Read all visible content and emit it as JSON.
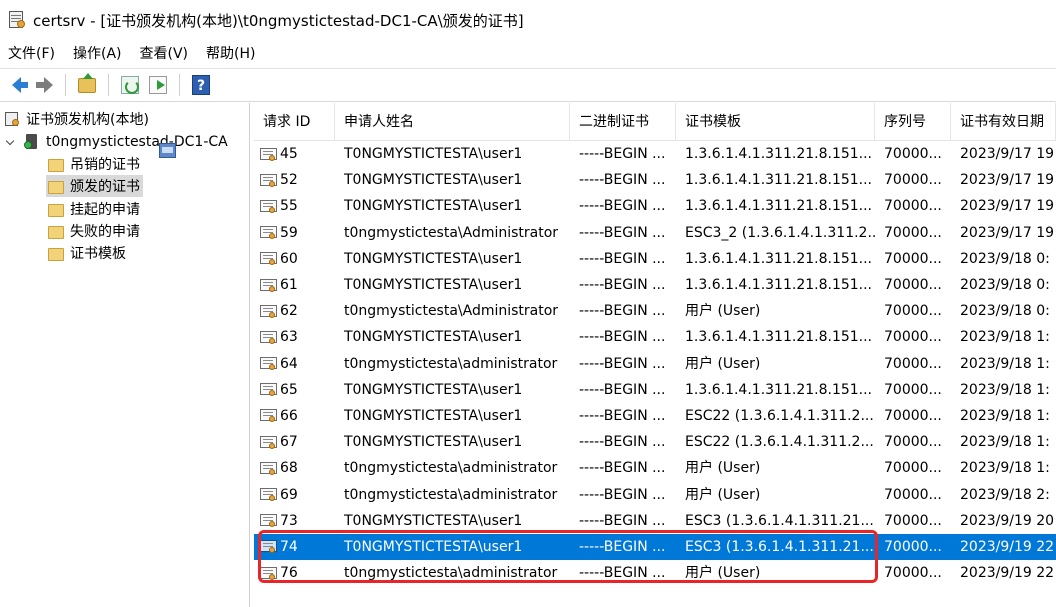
{
  "window": {
    "title": "certsrv - [证书颁发机构(本地)\\t0ngmystictestad-DC1-CA\\颁发的证书]"
  },
  "menu": [
    "文件(F)",
    "操作(A)",
    "查看(V)",
    "帮助(H)"
  ],
  "toolbar": {
    "buttons": [
      "back",
      "forward",
      "up-folder",
      "refresh",
      "export-list",
      "help"
    ],
    "help_glyph": "?"
  },
  "tree": {
    "root": "证书颁发机构(本地)",
    "ca": "t0ngmystictestad-DC1-CA",
    "folders": [
      "吊销的证书",
      "颁发的证书",
      "挂起的申请",
      "失败的申请",
      "证书模板"
    ],
    "selected": "颁发的证书"
  },
  "columns": [
    "请求 ID",
    "申请人姓名",
    "二进制证书",
    "证书模板",
    "序列号",
    "证书有效日期"
  ],
  "rows": [
    {
      "id": "45",
      "name": "T0NGMYSTICTESTA\\user1",
      "binary": "-----BEGIN ...",
      "template": "1.3.6.1.4.1.311.21.8.151...",
      "serial": "70000...",
      "date": "2023/9/17 19"
    },
    {
      "id": "52",
      "name": "T0NGMYSTICTESTA\\user1",
      "binary": "-----BEGIN ...",
      "template": "1.3.6.1.4.1.311.21.8.151...",
      "serial": "70000...",
      "date": "2023/9/17 19"
    },
    {
      "id": "55",
      "name": "T0NGMYSTICTESTA\\user1",
      "binary": "-----BEGIN ...",
      "template": "1.3.6.1.4.1.311.21.8.151...",
      "serial": "70000...",
      "date": "2023/9/17 19"
    },
    {
      "id": "59",
      "name": "t0ngmystictesta\\Administrator",
      "binary": "-----BEGIN ...",
      "template": "ESC3_2 (1.3.6.1.4.1.311.2...",
      "serial": "70000...",
      "date": "2023/9/17 19"
    },
    {
      "id": "60",
      "name": "T0NGMYSTICTESTA\\user1",
      "binary": "-----BEGIN ...",
      "template": "1.3.6.1.4.1.311.21.8.151...",
      "serial": "70000...",
      "date": "2023/9/18 0:"
    },
    {
      "id": "61",
      "name": "T0NGMYSTICTESTA\\user1",
      "binary": "-----BEGIN ...",
      "template": "1.3.6.1.4.1.311.21.8.151...",
      "serial": "70000...",
      "date": "2023/9/18 0:"
    },
    {
      "id": "62",
      "name": "t0ngmystictesta\\Administrator",
      "binary": "-----BEGIN ...",
      "template": "用户 (User)",
      "serial": "70000...",
      "date": "2023/9/18 0:"
    },
    {
      "id": "63",
      "name": "T0NGMYSTICTESTA\\user1",
      "binary": "-----BEGIN ...",
      "template": "1.3.6.1.4.1.311.21.8.151...",
      "serial": "70000...",
      "date": "2023/9/18 1:"
    },
    {
      "id": "64",
      "name": "t0ngmystictesta\\administrator",
      "binary": "-----BEGIN ...",
      "template": "用户 (User)",
      "serial": "70000...",
      "date": "2023/9/18 1:"
    },
    {
      "id": "65",
      "name": "T0NGMYSTICTESTA\\user1",
      "binary": "-----BEGIN ...",
      "template": "1.3.6.1.4.1.311.21.8.151...",
      "serial": "70000...",
      "date": "2023/9/18 1:"
    },
    {
      "id": "66",
      "name": "T0NGMYSTICTESTA\\user1",
      "binary": "-----BEGIN ...",
      "template": "ESC22 (1.3.6.1.4.1.311.2...",
      "serial": "70000...",
      "date": "2023/9/18 1:"
    },
    {
      "id": "67",
      "name": "T0NGMYSTICTESTA\\user1",
      "binary": "-----BEGIN ...",
      "template": "ESC22 (1.3.6.1.4.1.311.2...",
      "serial": "70000...",
      "date": "2023/9/18 1:"
    },
    {
      "id": "68",
      "name": "t0ngmystictesta\\administrator",
      "binary": "-----BEGIN ...",
      "template": "用户 (User)",
      "serial": "70000...",
      "date": "2023/9/18 1:"
    },
    {
      "id": "69",
      "name": "t0ngmystictesta\\administrator",
      "binary": "-----BEGIN ...",
      "template": "用户 (User)",
      "serial": "70000...",
      "date": "2023/9/18 2:"
    },
    {
      "id": "73",
      "name": "T0NGMYSTICTESTA\\user1",
      "binary": "-----BEGIN ...",
      "template": "ESC3 (1.3.6.1.4.1.311.21....",
      "serial": "70000...",
      "date": "2023/9/19 20"
    },
    {
      "id": "74",
      "name": "T0NGMYSTICTESTA\\user1",
      "binary": "-----BEGIN ...",
      "template": "ESC3 (1.3.6.1.4.1.311.21....",
      "serial": "70000...",
      "date": "2023/9/19 22",
      "selected": true
    },
    {
      "id": "76",
      "name": "t0ngmystictesta\\administrator",
      "binary": "-----BEGIN ...",
      "template": "用户 (User)",
      "serial": "70000...",
      "date": "2023/9/19 22"
    }
  ],
  "colors": {
    "selection": "#0078d7",
    "highlight_box": "#e8262a",
    "tree_selection": "#d9d9d9"
  }
}
